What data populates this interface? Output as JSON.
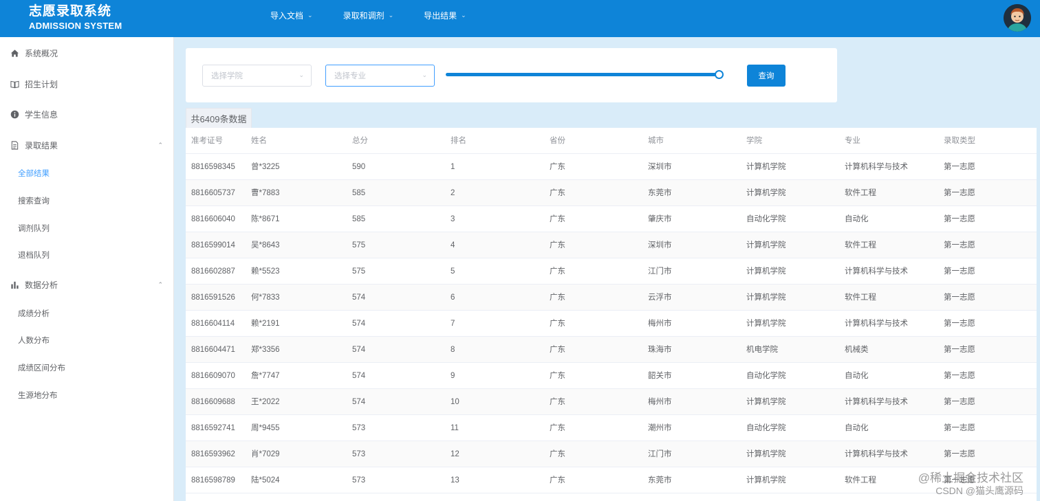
{
  "header": {
    "brand_cn": "志愿录取系统",
    "brand_en": "ADMISSION SYSTEM",
    "nav": [
      {
        "label": "导入文档"
      },
      {
        "label": "录取和调剂"
      },
      {
        "label": "导出结果"
      }
    ],
    "accent_color": "#0e84d8"
  },
  "sidebar": {
    "items": [
      {
        "label": "系统概况",
        "icon": "home-icon"
      },
      {
        "label": "招生计划",
        "icon": "book-icon"
      },
      {
        "label": "学生信息",
        "icon": "info-icon"
      },
      {
        "label": "录取结果",
        "icon": "document-icon",
        "expanded": true
      },
      {
        "label": "数据分析",
        "icon": "bar-chart-icon",
        "expanded": true
      }
    ],
    "result_sub": [
      {
        "label": "全部结果",
        "active": true
      },
      {
        "label": "搜索查询"
      },
      {
        "label": "调剂队列"
      },
      {
        "label": "退档队列"
      }
    ],
    "analysis_sub": [
      {
        "label": "成绩分析"
      },
      {
        "label": "人数分布"
      },
      {
        "label": "成绩区间分布"
      },
      {
        "label": "生源地分布"
      }
    ]
  },
  "filter": {
    "college_placeholder": "选择学院",
    "major_placeholder": "选择专业",
    "slider_value_fraction": 1.0,
    "query_label": "查询"
  },
  "count_label": "共6409条数据",
  "table": {
    "columns": [
      "准考证号",
      "姓名",
      "总分",
      "排名",
      "省份",
      "城市",
      "学院",
      "专业",
      "录取类型"
    ],
    "rows": [
      [
        "8816598345",
        "曾*3225",
        "590",
        "1",
        "广东",
        "深圳市",
        "计算机学院",
        "计算机科学与技术",
        "第一志愿"
      ],
      [
        "8816605737",
        "曹*7883",
        "585",
        "2",
        "广东",
        "东莞市",
        "计算机学院",
        "软件工程",
        "第一志愿"
      ],
      [
        "8816606040",
        "陈*8671",
        "585",
        "3",
        "广东",
        "肇庆市",
        "自动化学院",
        "自动化",
        "第一志愿"
      ],
      [
        "8816599014",
        "吴*8643",
        "575",
        "4",
        "广东",
        "深圳市",
        "计算机学院",
        "软件工程",
        "第一志愿"
      ],
      [
        "8816602887",
        "赖*5523",
        "575",
        "5",
        "广东",
        "江门市",
        "计算机学院",
        "计算机科学与技术",
        "第一志愿"
      ],
      [
        "8816591526",
        "何*7833",
        "574",
        "6",
        "广东",
        "云浮市",
        "计算机学院",
        "软件工程",
        "第一志愿"
      ],
      [
        "8816604114",
        "赖*2191",
        "574",
        "7",
        "广东",
        "梅州市",
        "计算机学院",
        "计算机科学与技术",
        "第一志愿"
      ],
      [
        "8816604471",
        "郑*3356",
        "574",
        "8",
        "广东",
        "珠海市",
        "机电学院",
        "机械类",
        "第一志愿"
      ],
      [
        "8816609070",
        "詹*7747",
        "574",
        "9",
        "广东",
        "韶关市",
        "自动化学院",
        "自动化",
        "第一志愿"
      ],
      [
        "8816609688",
        "王*2022",
        "574",
        "10",
        "广东",
        "梅州市",
        "计算机学院",
        "计算机科学与技术",
        "第一志愿"
      ],
      [
        "8816592741",
        "周*9455",
        "573",
        "11",
        "广东",
        "潮州市",
        "自动化学院",
        "自动化",
        "第一志愿"
      ],
      [
        "8816593962",
        "肖*7029",
        "573",
        "12",
        "广东",
        "江门市",
        "计算机学院",
        "计算机科学与技术",
        "第一志愿"
      ],
      [
        "8816598789",
        "陆*5024",
        "573",
        "13",
        "广东",
        "东莞市",
        "计算机学院",
        "软件工程",
        "第一志愿"
      ]
    ]
  },
  "watermark": {
    "line1": "@稀土掘金技术社区",
    "line2": "CSDN @猫头鹰源码"
  }
}
